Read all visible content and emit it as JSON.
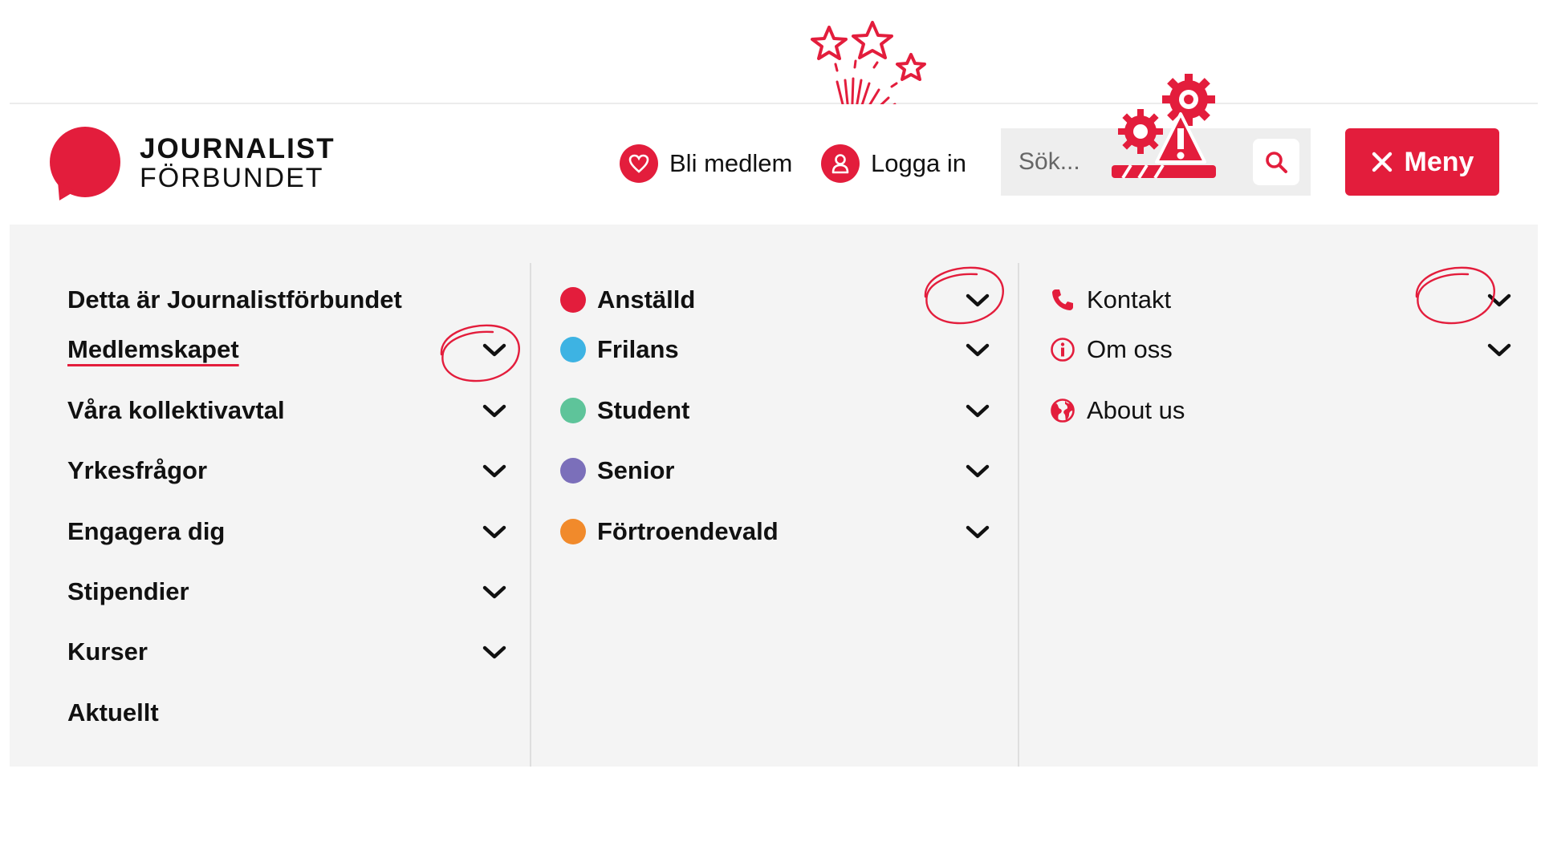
{
  "brand": {
    "line1": "JOURNALIST",
    "line2": "FÖRBUNDET",
    "color": "#e31d3c"
  },
  "header": {
    "join_label": "Bli medlem",
    "join_icon": "heart-icon",
    "login_label": "Logga in",
    "login_icon": "user-icon",
    "search": {
      "placeholder": "Sök...",
      "value": "",
      "icon": "search-icon"
    },
    "menu_button": {
      "label": "Meny",
      "icon": "close-icon"
    }
  },
  "menu": {
    "column1": [
      {
        "label": "Detta är Journalistförbundet",
        "expandable": false
      },
      {
        "label": "Medlemskapet",
        "expandable": true,
        "active": true
      },
      {
        "label": "Våra kollektivavtal",
        "expandable": true
      },
      {
        "label": "Yrkesfrågor",
        "expandable": true
      },
      {
        "label": "Engagera dig",
        "expandable": true
      },
      {
        "label": "Stipendier",
        "expandable": true
      },
      {
        "label": "Kurser",
        "expandable": true
      },
      {
        "label": "Aktuellt",
        "expandable": false
      }
    ],
    "column2": [
      {
        "label": "Anställd",
        "dot_color": "#e31d3c",
        "expandable": true
      },
      {
        "label": "Frilans",
        "dot_color": "#3db3e3",
        "expandable": true
      },
      {
        "label": "Student",
        "dot_color": "#5ec49a",
        "expandable": true
      },
      {
        "label": "Senior",
        "dot_color": "#7b6fba",
        "expandable": true
      },
      {
        "label": "Förtroendevald",
        "dot_color": "#f18a2b",
        "expandable": true
      }
    ],
    "column3": [
      {
        "label": "Kontakt",
        "icon": "phone-icon",
        "expandable": true
      },
      {
        "label": "Om oss",
        "icon": "info-icon",
        "expandable": true
      },
      {
        "label": "About us",
        "icon": "globe-icon",
        "expandable": false
      }
    ]
  },
  "decorations": [
    "fireworks-sticker",
    "gear-warning-sticker",
    "hand-drawn-circle"
  ]
}
